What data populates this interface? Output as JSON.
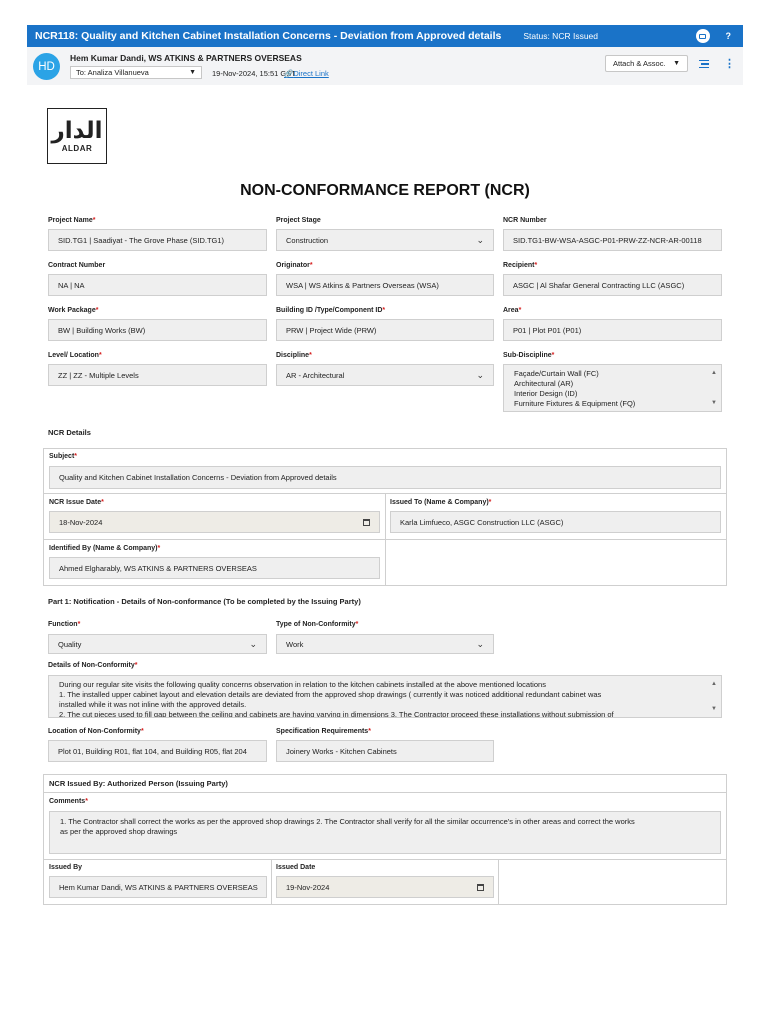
{
  "topbar": {
    "title": "NCR118: Quality and Kitchen Cabinet Installation Concerns - Deviation from Approved details",
    "status": "Status: NCR Issued",
    "help": "?"
  },
  "header": {
    "avatar_initials": "HD",
    "sender": "Hem Kumar Dandi, WS ATKINS & PARTNERS OVERSEAS",
    "to": "To: Analiza Villanueva",
    "date": "19-Nov-2024, 15:51 GST",
    "direct_link": "Direct Link",
    "attach": "Attach & Assoc."
  },
  "logo": {
    "word": "ALDAR"
  },
  "form": {
    "title": "NON-CONFORMANCE REPORT (NCR)",
    "project_name": {
      "label": "Project Name",
      "value": "SID.TG1 | Saadiyat - The Grove Phase (SID.TG1)"
    },
    "project_stage": {
      "label": "Project Stage",
      "value": "Construction"
    },
    "ncr_number": {
      "label": "NCR Number",
      "value": "SID.TG1-BW-WSA-ASGC-P01-PRW-ZZ-NCR-AR-00118"
    },
    "contract_number": {
      "label": "Contract Number",
      "value": "NA | NA"
    },
    "originator": {
      "label": "Originator",
      "value": "WSA | WS Atkins & Partners Overseas (WSA)"
    },
    "recipient": {
      "label": "Recipient",
      "value": "ASGC | Al Shafar General Contracting LLC (ASGC)"
    },
    "work_package": {
      "label": "Work Package",
      "value": "BW | Building Works (BW)"
    },
    "building_id": {
      "label": "Building ID /Type/Component ID",
      "value": "PRW | Project Wide (PRW)"
    },
    "area": {
      "label": "Area",
      "value": "P01 | Plot P01 (P01)"
    },
    "level": {
      "label": "Level/ Location",
      "value": "ZZ | ZZ - Multiple Levels"
    },
    "discipline": {
      "label": "Discipline",
      "value": "AR - Architectural"
    },
    "sub_discipline": {
      "label": "Sub-Discipline",
      "options": [
        "Façade/Curtain Wall (FC)",
        "Architectural (AR)",
        "Interior Design (ID)",
        "Furniture Fixtures & Equipment (FQ)"
      ]
    }
  },
  "ncr_details": {
    "section_title": "NCR Details",
    "subject": {
      "label": "Subject",
      "value": "Quality and Kitchen Cabinet Installation Concerns - Deviation from Approved details"
    },
    "issue_date": {
      "label": "NCR Issue Date",
      "value": "18-Nov-2024"
    },
    "issued_to": {
      "label": "Issued To (Name & Company)",
      "value": "Karla Limfueco, ASGC Construction LLC (ASGC)"
    },
    "identified_by": {
      "label": "Identified By (Name & Company)",
      "value": "Ahmed Elgharably, WS ATKINS & PARTNERS OVERSEAS"
    }
  },
  "part1": {
    "section_title": "Part 1: Notification - Details of Non-conformance (To be completed by the Issuing Party)",
    "function": {
      "label": "Function",
      "value": "Quality"
    },
    "type": {
      "label": "Type of Non-Conformity",
      "value": "Work"
    },
    "details": {
      "label": "Details of Non-Conformity",
      "line1": "During our regular site visits the following quality concerns observation in relation to the kitchen cabinets installed at the above mentioned locations",
      "line2": "1. The installed upper cabinet layout and elevation details are deviated from the approved shop drawings ( currently it was noticed additional redundant cabinet was",
      "line3": "installed while it was not inline with the approved details.",
      "line4": "2. The cut pieces used to fill gap between the ceiling and cabinets are having varying in dimensions 3. The Contractor proceed these installations without submission of"
    },
    "location": {
      "label": "Location of Non-Conformity",
      "value": "Plot 01, Building R01, flat 104, and Building R05, flat 204"
    },
    "spec": {
      "label": "Specification Requirements",
      "value": "Joinery Works - Kitchen Cabinets"
    }
  },
  "issued_section": {
    "section_title": "NCR Issued By: Authorized Person (Issuing Party)",
    "comments": {
      "label": "Comments",
      "line1": "1. The Contractor shall correct the works as per the approved shop drawings 2. The Contractor shall verify for all the similar occurrence's in other areas and correct the works",
      "line2": "as per the approved shop drawings"
    },
    "issued_by": {
      "label": "Issued By",
      "value": "Hem Kumar Dandi, WS ATKINS & PARTNERS OVERSEAS"
    },
    "issued_date": {
      "label": "Issued Date",
      "value": "19-Nov-2024"
    }
  }
}
